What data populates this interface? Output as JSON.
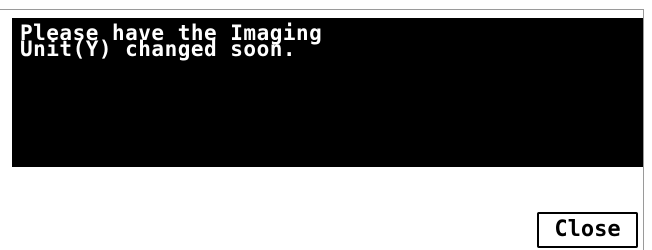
{
  "dialog": {
    "message": "Please have the Imaging\nUnit(Y) changed soon.",
    "close_label": "Close"
  },
  "colors": {
    "panel_background": "#000000",
    "panel_text": "#ffffff",
    "dialog_background": "#ffffff",
    "button_border": "#000000"
  }
}
